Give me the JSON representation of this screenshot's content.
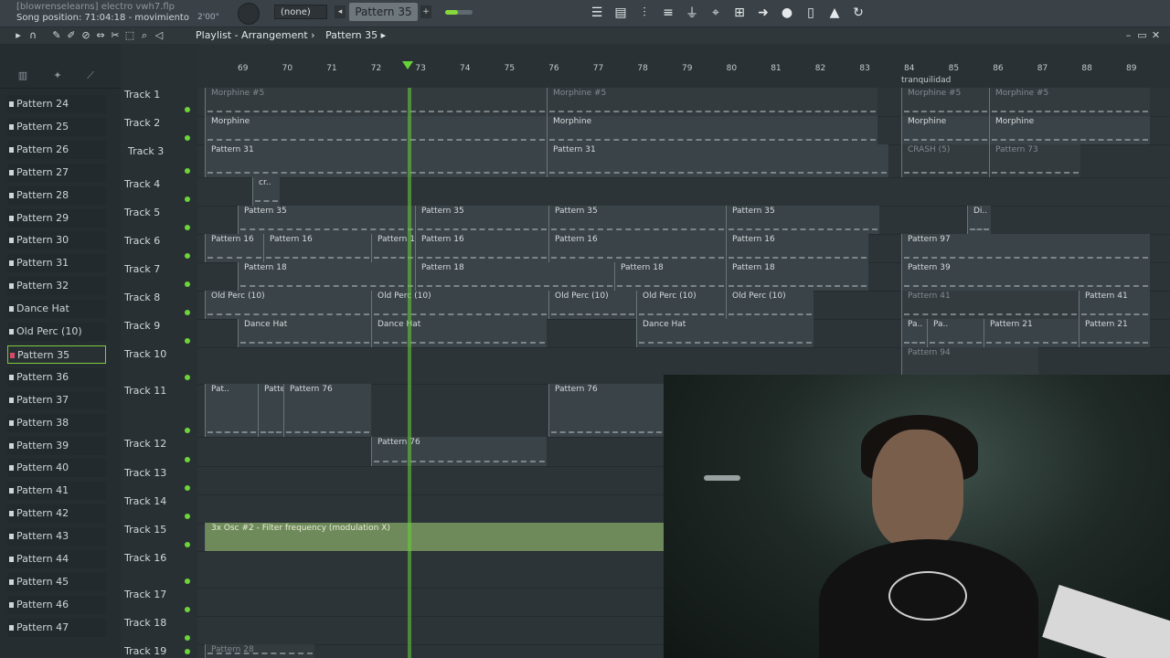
{
  "topbar": {
    "filename": "[blowrenselearns] electro vwh7.flp",
    "song_position": "Song position: 71:04:18 - movimiento",
    "time": "2'00\"",
    "channel": "(none)",
    "pattern": "Pattern 35",
    "prev": "◂",
    "next": "+"
  },
  "toolbar_icons": [
    "playlist-icon",
    "piano-roll-icon",
    "mixer-icon",
    "channel-rack-icon",
    "plugin-icon",
    "browser-icon",
    "tempo-icon",
    "arrow-icon",
    "mic-icon",
    "file-icon",
    "stamp-icon",
    "refresh-icon"
  ],
  "window": {
    "title": "Playlist - Arrangement",
    "crumb_sep": "›",
    "crumb_pattern": "Pattern 35",
    "crumb_end": "▸"
  },
  "patterns": [
    {
      "label": "Pattern 24"
    },
    {
      "label": "Pattern 25"
    },
    {
      "label": "Pattern 26"
    },
    {
      "label": "Pattern 27"
    },
    {
      "label": "Pattern 28"
    },
    {
      "label": "Pattern 29"
    },
    {
      "label": "Pattern 30"
    },
    {
      "label": "Pattern 31"
    },
    {
      "label": "Pattern 32"
    },
    {
      "label": "Dance Hat"
    },
    {
      "label": "Old Perc (10)"
    },
    {
      "label": "Pattern 35"
    },
    {
      "label": "Pattern 36"
    },
    {
      "label": "Pattern 37"
    },
    {
      "label": "Pattern 38"
    },
    {
      "label": "Pattern 39"
    },
    {
      "label": "Pattern 40"
    },
    {
      "label": "Pattern 41"
    },
    {
      "label": "Pattern 42"
    },
    {
      "label": "Pattern 43"
    },
    {
      "label": "Pattern 44"
    },
    {
      "label": "Pattern 45"
    },
    {
      "label": "Pattern 46"
    },
    {
      "label": "Pattern 47"
    }
  ],
  "selected_pattern": "Pattern 35",
  "ruler": {
    "bars": [
      "69",
      "70",
      "71",
      "72",
      "73",
      "74",
      "75",
      "76",
      "77",
      "78",
      "79",
      "80",
      "81",
      "82",
      "83",
      "84",
      "85",
      "86",
      "87",
      "88",
      "89"
    ],
    "marker": "tranquilidad"
  },
  "tracks": [
    "Track 1",
    "Track 2",
    "Track 3",
    "Track 4",
    "Track 5",
    "Track 6",
    "Track 7",
    "Track 8",
    "Track 9",
    "Track 10",
    "Track 11",
    "Track 12",
    "Track 13",
    "Track 14",
    "Track 15",
    "Track 16",
    "Track 17",
    "Track 18",
    "Track 19"
  ],
  "clips": {
    "morphine5": "Morphine #5",
    "morphine": "Morphine",
    "pattern31": "Pattern 31",
    "crash": "CRASH (5)",
    "pattern73": "Pattern 73",
    "cr": "cr..",
    "pattern35": "Pattern 35",
    "di": "Di..",
    "pattern16": "Pattern 16",
    "pattern97": "Pattern 97",
    "pattern18": "Pattern 18",
    "pattern39": "Pattern 39",
    "oldperc": "Old Perc (10)",
    "pattern41": "Pattern 41",
    "dancehat": "Dance Hat",
    "pa": "Pa..",
    "pattern21": "Pattern 21",
    "pattern94": "Pattern 94",
    "pat": "Pat..",
    "pattern76": "Pattern 76",
    "automation": "3x Osc #2 - Filter frequency (modulation X)",
    "pattern28": "Pattern 28"
  }
}
